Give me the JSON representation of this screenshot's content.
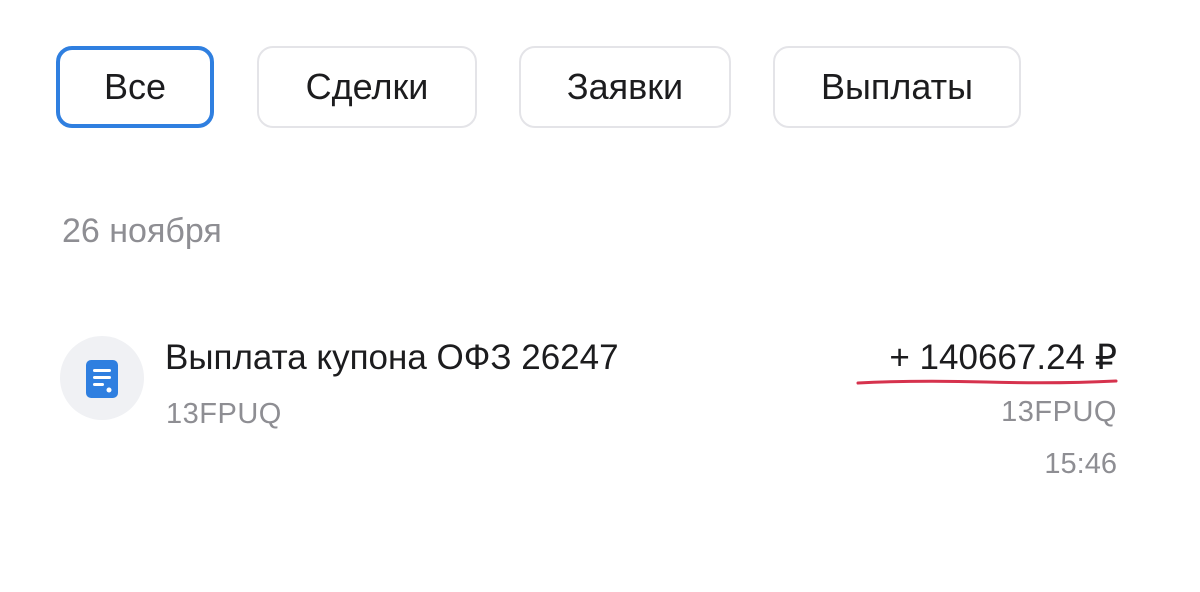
{
  "filters": {
    "tabs": [
      {
        "label": "Все",
        "active": true
      },
      {
        "label": "Сделки",
        "active": false
      },
      {
        "label": "Заявки",
        "active": false
      },
      {
        "label": "Выплаты",
        "active": false
      }
    ],
    "accent_color": "#2f7fe0"
  },
  "feed": {
    "groups": [
      {
        "date": "26 ноября",
        "items": [
          {
            "icon": "document-icon",
            "title": "Выплата купона ОФЗ 26247",
            "account": "13FPUQ",
            "amount": "+ 140667.24 ₽",
            "account_right": "13FPUQ",
            "time": "15:46",
            "highlight_color": "#d6324d"
          }
        ]
      }
    ]
  }
}
